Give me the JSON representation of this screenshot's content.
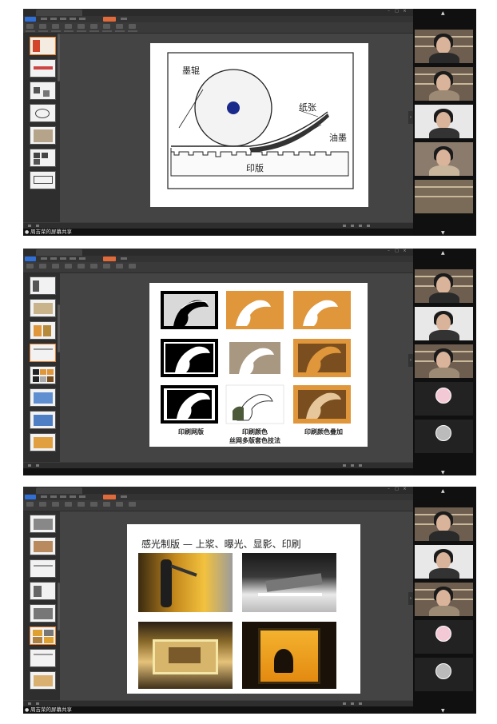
{
  "share_label": "周吉荣的屏幕共享",
  "slide1": {
    "labels": {
      "roller": "墨辊",
      "paper": "纸张",
      "ink": "油墨",
      "plate": "印版"
    }
  },
  "slide2": {
    "captions": {
      "col1": "印刷网版",
      "col2_line1": "印刷颜色",
      "col2_line2": "丝网多版套色技法",
      "col3": "印刷颜色叠加"
    }
  },
  "slide3": {
    "title": "感光制版 — 上浆、曝光、显影、印刷"
  },
  "colors": {
    "accent_orange": "#e0963a",
    "taupe": "#a89882",
    "brown": "#7a4e1e",
    "roller_dot": "#1a2a8c"
  }
}
